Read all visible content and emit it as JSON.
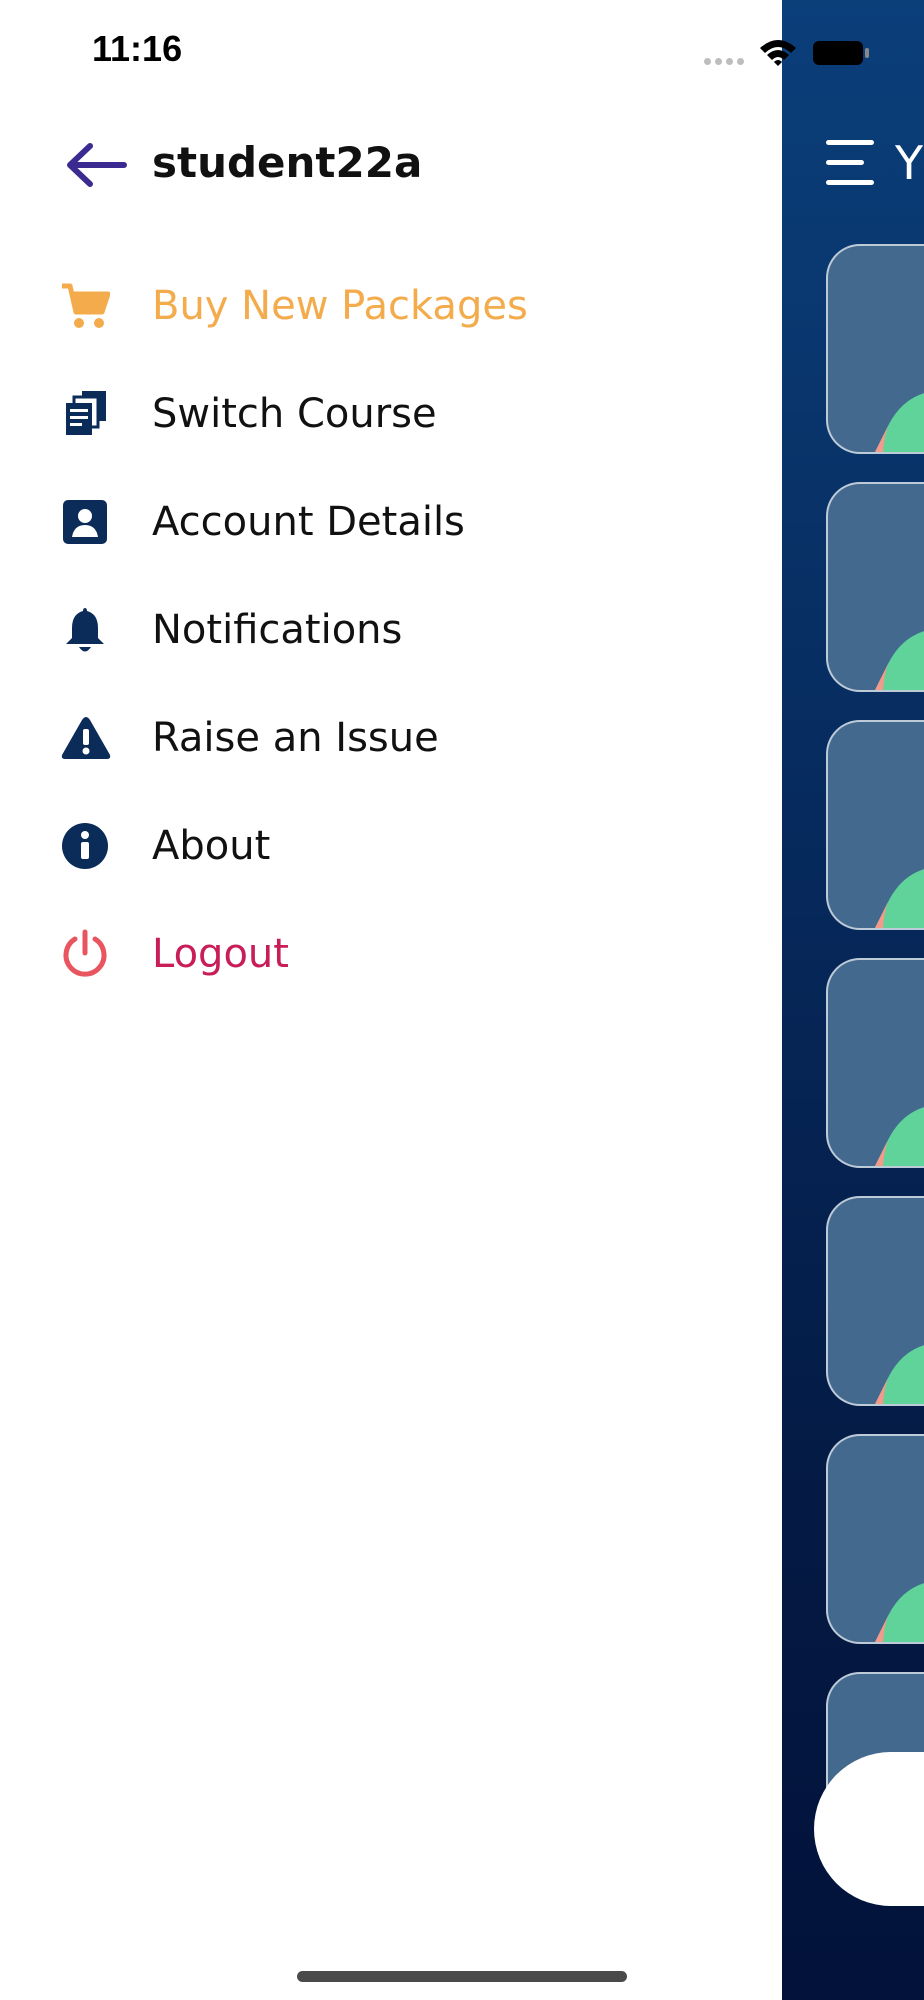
{
  "status_bar": {
    "time": "11:16"
  },
  "drawer": {
    "username": "student22a",
    "items": [
      {
        "label": "Buy New Packages",
        "icon": "cart-icon",
        "color": "#f4ab4b"
      },
      {
        "label": "Switch Course",
        "icon": "switch-course-icon",
        "color": "#0b2b59"
      },
      {
        "label": "Account Details",
        "icon": "account-card-icon",
        "color": "#0b2b59"
      },
      {
        "label": "Notifications",
        "icon": "bell-icon",
        "color": "#0b2b59"
      },
      {
        "label": "Raise an Issue",
        "icon": "warning-icon",
        "color": "#0b2b59"
      },
      {
        "label": "About",
        "icon": "info-icon",
        "color": "#0b2b59"
      },
      {
        "label": "Logout",
        "icon": "power-icon",
        "color": "#c81d59"
      }
    ]
  },
  "background": {
    "title_fragment": "Y"
  },
  "colors": {
    "accent": "#f4ab4b",
    "logout": "#c81d59",
    "back_arrow": "#3b2a8f",
    "panel": "#06285a"
  }
}
